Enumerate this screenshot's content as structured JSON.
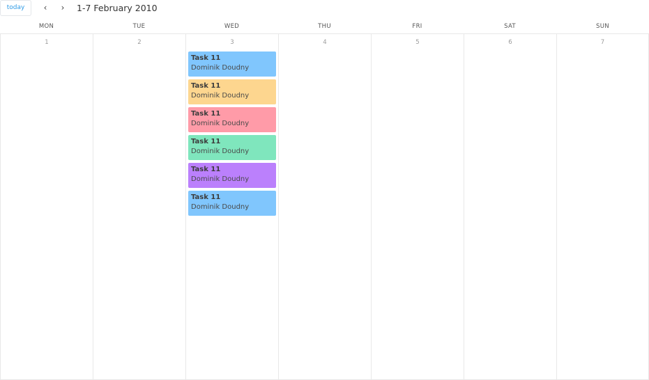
{
  "toolbar": {
    "today_label": "today",
    "prev_glyph": "‹",
    "next_glyph": "›",
    "prev_icon": "chevron-left-icon",
    "next_icon": "chevron-right-icon",
    "range_title": "1-7 February 2010"
  },
  "colors": {
    "today_text": "#2f9be6",
    "grid_line": "#e8e8e8",
    "day_number": "#9a9a9a"
  },
  "days": [
    {
      "name": "MON",
      "number": "1",
      "events": []
    },
    {
      "name": "TUE",
      "number": "2",
      "events": []
    },
    {
      "name": "WED",
      "number": "3",
      "events": [
        {
          "title": "Task 11",
          "person": "Dominik Doudny",
          "color": "#80c6fd"
        },
        {
          "title": "Task 11",
          "person": "Dominik Doudny",
          "color": "#fdd68f"
        },
        {
          "title": "Task 11",
          "person": "Dominik Doudny",
          "color": "#ff9ba8"
        },
        {
          "title": "Task 11",
          "person": "Dominik Doudny",
          "color": "#7fe6bd"
        },
        {
          "title": "Task 11",
          "person": "Dominik Doudny",
          "color": "#bb80fc"
        },
        {
          "title": "Task 11",
          "person": "Dominik Doudny",
          "color": "#80c6fd"
        }
      ]
    },
    {
      "name": "THU",
      "number": "4",
      "events": []
    },
    {
      "name": "FRI",
      "number": "5",
      "events": []
    },
    {
      "name": "SAT",
      "number": "6",
      "events": []
    },
    {
      "name": "SUN",
      "number": "7",
      "events": []
    }
  ]
}
